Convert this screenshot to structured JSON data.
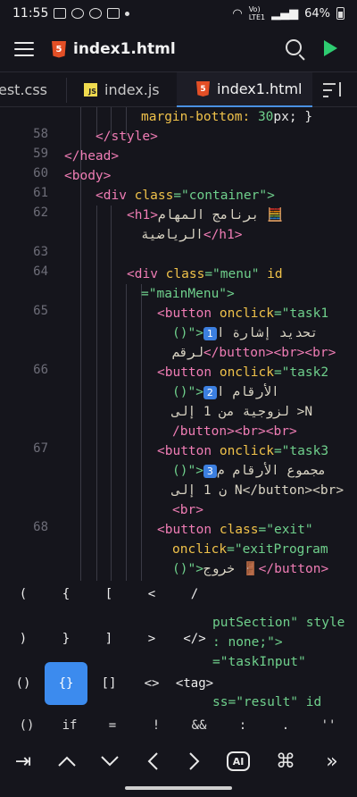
{
  "status": {
    "time": "11:55",
    "battery": "64%"
  },
  "appbar": {
    "title": "index1.html"
  },
  "tabs": [
    {
      "label": "est.css"
    },
    {
      "label": "index.js"
    },
    {
      "label": "index1.html"
    }
  ],
  "editor": {
    "line_numbers": [
      "58",
      "59",
      "60",
      "61",
      "62",
      "63",
      "64",
      "65",
      "66",
      "67",
      "68"
    ],
    "lines": {
      "l0a": "margin-bottom: ",
      "l0b": "30",
      "l0c": "px; }",
      "l58a": "</",
      "l58b": "style",
      "l58c": ">",
      "l59": "</head>",
      "l60": "<body>",
      "l61a": "<div ",
      "l61b": "class",
      "l61c": "=\"container\">",
      "l62a": "<h1>",
      "l62b": "🧮 برنامج المهام",
      "l62c": "الرياضية",
      "l62d": "</h1>",
      "l64a": "<div ",
      "l64b": "class",
      "l64c": "=\"menu\" ",
      "l64d": "id",
      "l64e": "=\"mainMenu\">",
      "l65a": "<button ",
      "l65b": "onclick",
      "l65c": "=\"task1",
      "l65d": "()\">",
      "l65e": "1",
      "l65f": " تحديد إشارة ا",
      "l65g": "لرقم",
      "l65h": "</button><br><br>",
      "l66a": "<button ",
      "l66b": "onclick",
      "l66c": "=\"task2",
      "l66d": "()\">",
      "l66e": "2",
      "l66f": " الأرقام ا",
      "l66g": "N< لزوجية من 1 إلى",
      "l66h": "/button><br><br>",
      "l67a": "<button ",
      "l67b": "onclick",
      "l67c": "=\"task3",
      "l67d": "()\">",
      "l67e": "3",
      "l67f": " مجموع الأرقام م",
      "l67g": "ن 1 إلى N</button><br>",
      "l67h": "<br>",
      "l68a": "<button ",
      "l68b": "class",
      "l68c": "=\"exit\"",
      "l68d": "onclick",
      "l68e": "=\"exitProgram",
      "l68f": "()\">",
      "l68g": "🚪 خروج",
      "l68h": "</button>"
    }
  },
  "keys": {
    "row1": [
      "(",
      "{",
      "[",
      "<",
      "/"
    ],
    "row2": [
      ")",
      "}",
      "]",
      ">",
      "</>"
    ],
    "row3": [
      "()",
      "{}",
      "[]",
      "<>",
      "<tag>"
    ],
    "behind1": "putSection\" style",
    "behind2": ": none;\">",
    "behind3": "=\"taskInput\"",
    "behind4": "ss=\"result\" id"
  },
  "snippets": [
    "()",
    "if",
    "=",
    "!",
    "&&",
    ":",
    ".",
    "''"
  ],
  "nav": {
    "ai": "AI"
  }
}
